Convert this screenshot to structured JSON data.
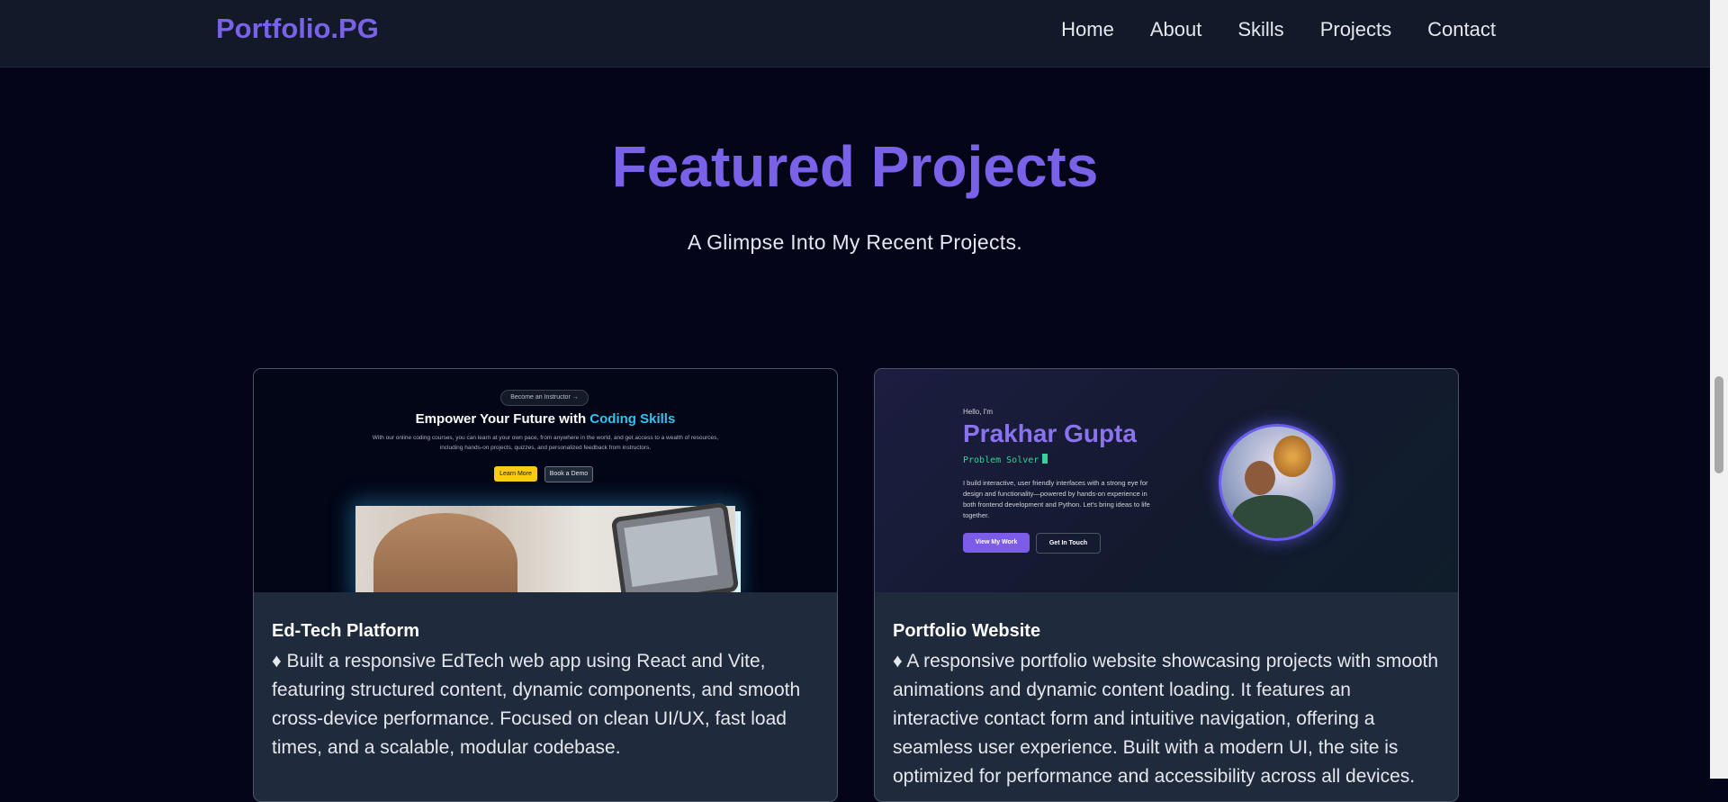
{
  "nav": {
    "brand": "Portfolio.PG",
    "links": [
      "Home",
      "About",
      "Skills",
      "Projects",
      "Contact"
    ]
  },
  "section": {
    "title": "Featured Projects",
    "subtitle": "A Glimpse Into My Recent Projects."
  },
  "projects": [
    {
      "title": "Ed-Tech Platform",
      "description": "♦ Built a responsive EdTech web app using React and Vite, featuring structured content, dynamic components, and smooth cross-device performance. Focused on clean UI/UX, fast load times, and a scalable, modular codebase.",
      "preview": {
        "pill": "Become an Instructor →",
        "headline": "Empower Your Future with ",
        "headline_accent": "Coding Skills",
        "subtext": "With our online coding courses, you can learn at your own pace, from anywhere in the world, and get access to a wealth of resources, including hands-on projects, quizzes, and personalized feedback from instructors.",
        "primary_button": "Learn More",
        "secondary_button": "Book a Demo"
      }
    },
    {
      "title": "Portfolio Website",
      "description": "♦ A responsive portfolio website showcasing projects with smooth animations and dynamic content loading. It features an interactive contact form and intuitive navigation, offering a seamless user experience. Built with a modern UI, the site is optimized for performance and accessibility across all devices.",
      "preview": {
        "greeting": "Hello, I'm",
        "name": "Prakhar Gupta",
        "role": "Problem Solver",
        "intro": "I build interactive, user friendly interfaces with a strong eye for design and functionality—powered by hands-on experience in both frontend development and Python. Let's bring ideas to life together.",
        "primary_button": "View My Work",
        "secondary_button": "Get In Touch"
      }
    }
  ],
  "colors": {
    "accent": "#7a62e8",
    "background": "#05051a",
    "nav_background": "#121a2a",
    "card_background": "#1f2a3c",
    "highlight_cyan": "#35c0ef",
    "cta_yellow": "#facc15",
    "terminal_green": "#34d399"
  }
}
